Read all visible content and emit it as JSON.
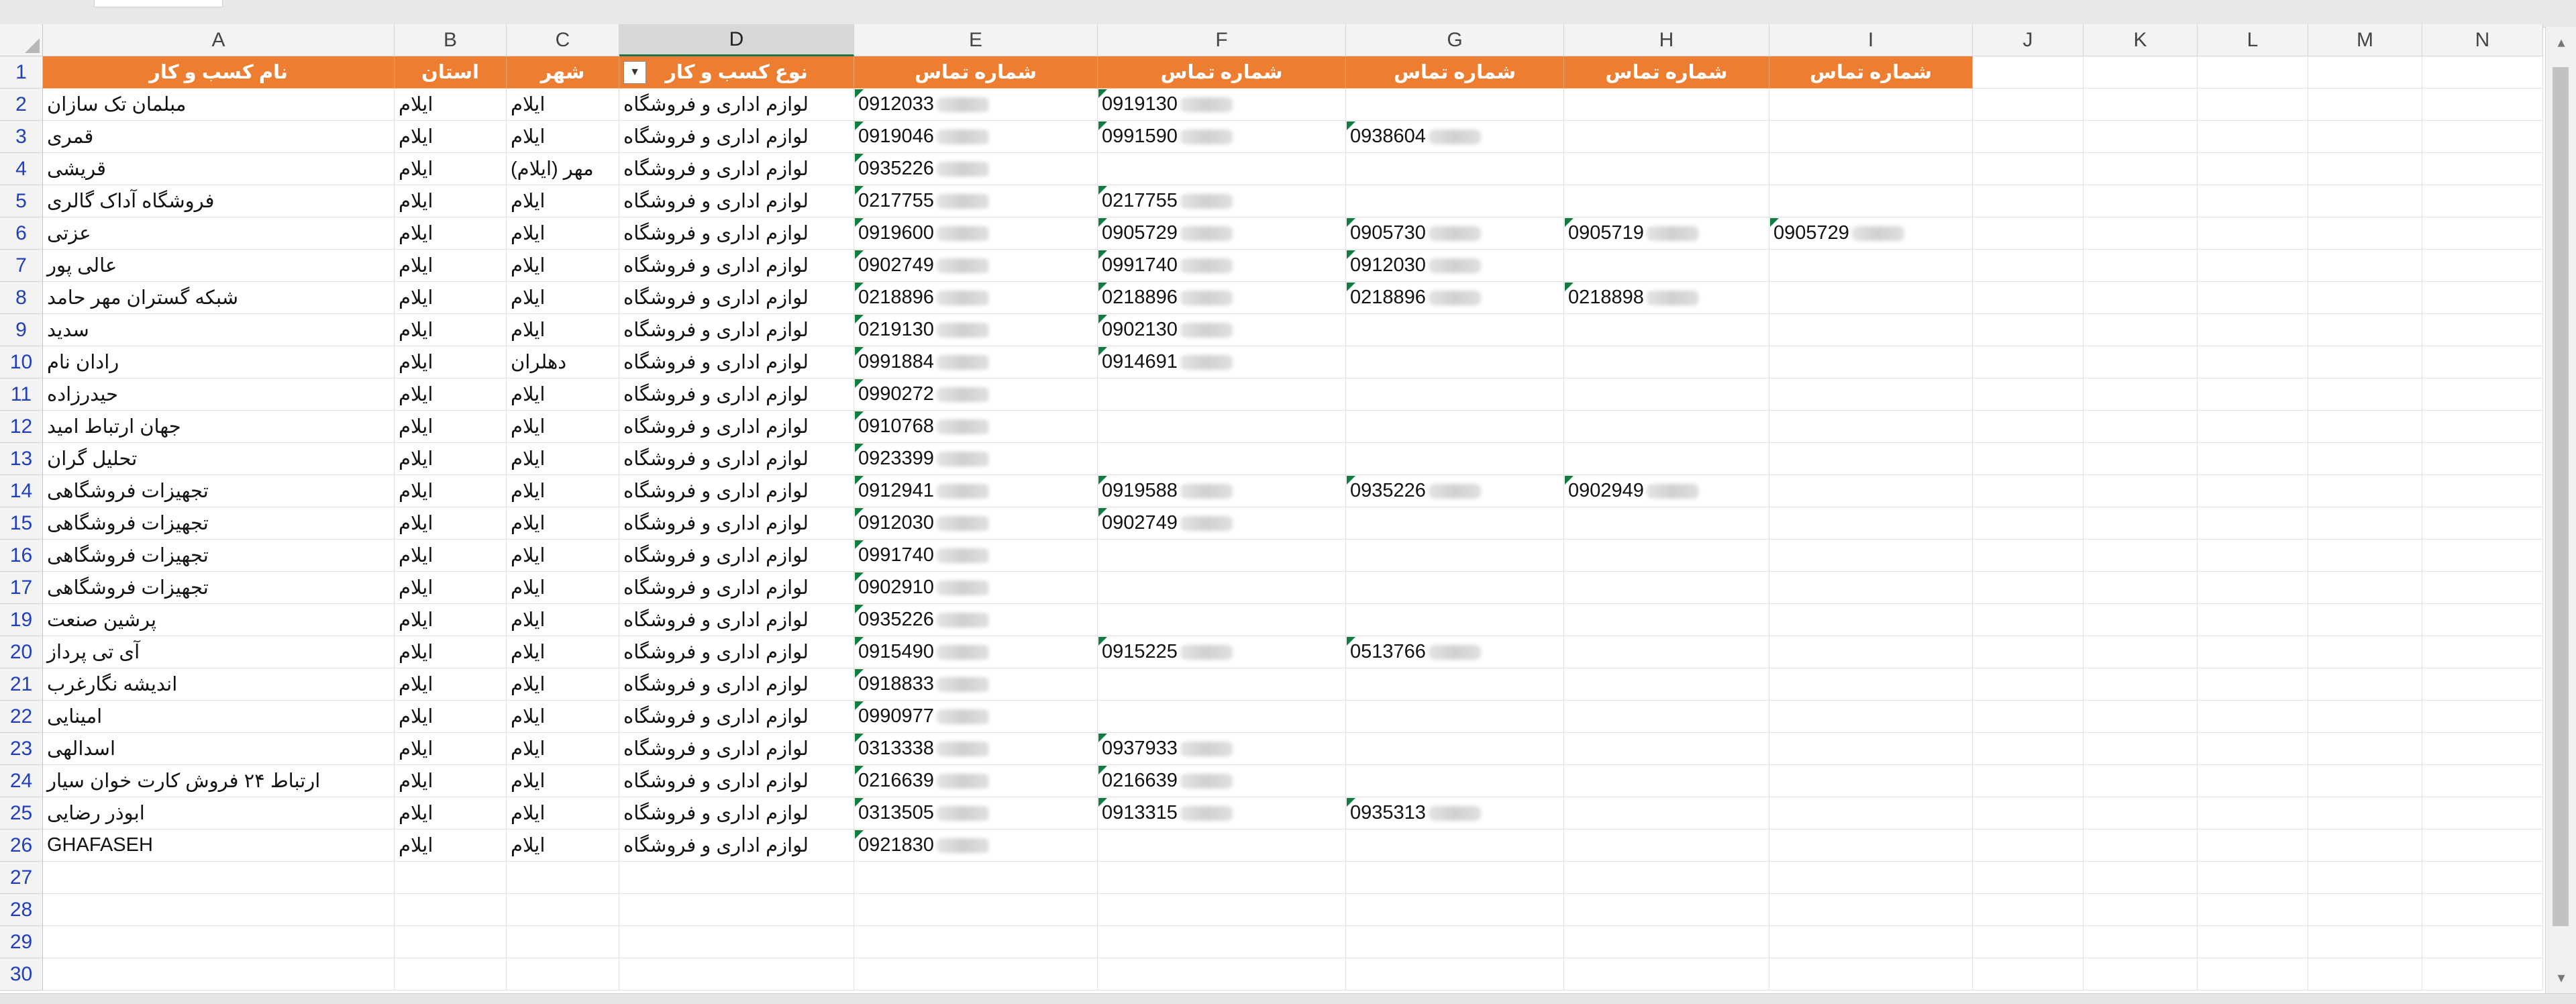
{
  "columns": [
    "A",
    "B",
    "C",
    "D",
    "E",
    "F",
    "G",
    "H",
    "I",
    "J",
    "K",
    "L",
    "M",
    "N"
  ],
  "selected_column": "D",
  "header_row": {
    "row": "1",
    "cells": [
      "نام کسب و کار",
      "استان",
      "شهر",
      "نوع کسب و کار",
      "شماره تماس",
      "شماره تماس",
      "شماره تماس",
      "شماره تماس",
      "شماره تماس"
    ]
  },
  "filter_icon": "filter-funnel-icon",
  "accent_color": "#ed7d31",
  "rows": [
    {
      "num": "2",
      "name": "مبلمان تک سازان",
      "province": "ایلام",
      "city": "ایلام",
      "type": "لوازم اداری و فروشگاه",
      "phones": [
        "0912033",
        "0919130"
      ]
    },
    {
      "num": "3",
      "name": "قمری",
      "province": "ایلام",
      "city": "ایلام",
      "type": "لوازم اداری و فروشگاه",
      "phones": [
        "0919046",
        "0991590",
        "0938604"
      ]
    },
    {
      "num": "4",
      "name": "قریشی",
      "province": "ایلام",
      "city": "مهر (ایلام)",
      "type": "لوازم اداری و فروشگاه",
      "phones": [
        "0935226"
      ]
    },
    {
      "num": "5",
      "name": "فروشگاه آداک گالری",
      "province": "ایلام",
      "city": "ایلام",
      "type": "لوازم اداری و فروشگاه",
      "phones": [
        "0217755",
        "0217755"
      ]
    },
    {
      "num": "6",
      "name": "عزتی",
      "province": "ایلام",
      "city": "ایلام",
      "type": "لوازم اداری و فروشگاه",
      "phones": [
        "0919600",
        "0905729",
        "0905730",
        "0905719",
        "0905729"
      ]
    },
    {
      "num": "7",
      "name": "عالی پور",
      "province": "ایلام",
      "city": "ایلام",
      "type": "لوازم اداری و فروشگاه",
      "phones": [
        "0902749",
        "0991740",
        "0912030"
      ]
    },
    {
      "num": "8",
      "name": "شبکه گستران مهر حامد",
      "province": "ایلام",
      "city": "ایلام",
      "type": "لوازم اداری و فروشگاه",
      "phones": [
        "0218896",
        "0218896",
        "0218896",
        "0218898"
      ]
    },
    {
      "num": "9",
      "name": "سدید",
      "province": "ایلام",
      "city": "ایلام",
      "type": "لوازم اداری و فروشگاه",
      "phones": [
        "0219130",
        "0902130"
      ]
    },
    {
      "num": "10",
      "name": "رادان نام",
      "province": "ایلام",
      "city": "دهلران",
      "type": "لوازم اداری و فروشگاه",
      "phones": [
        "0991884",
        "0914691"
      ]
    },
    {
      "num": "11",
      "name": "حیدرزاده",
      "province": "ایلام",
      "city": "ایلام",
      "type": "لوازم اداری و فروشگاه",
      "phones": [
        "0990272"
      ]
    },
    {
      "num": "12",
      "name": "جهان ارتباط امید",
      "province": "ایلام",
      "city": "ایلام",
      "type": "لوازم اداری و فروشگاه",
      "phones": [
        "0910768"
      ]
    },
    {
      "num": "13",
      "name": "تحلیل گران",
      "province": "ایلام",
      "city": "ایلام",
      "type": "لوازم اداری و فروشگاه",
      "phones": [
        "0923399"
      ]
    },
    {
      "num": "14",
      "name": "تجهیزات فروشگاهی",
      "province": "ایلام",
      "city": "ایلام",
      "type": "لوازم اداری و فروشگاه",
      "phones": [
        "0912941",
        "0919588",
        "0935226",
        "0902949"
      ]
    },
    {
      "num": "15",
      "name": "تجهیزات فروشگاهی",
      "province": "ایلام",
      "city": "ایلام",
      "type": "لوازم اداری و فروشگاه",
      "phones": [
        "0912030",
        "0902749"
      ]
    },
    {
      "num": "16",
      "name": "تجهیزات فروشگاهی",
      "province": "ایلام",
      "city": "ایلام",
      "type": "لوازم اداری و فروشگاه",
      "phones": [
        "0991740"
      ]
    },
    {
      "num": "17",
      "name": "تجهیزات فروشگاهی",
      "province": "ایلام",
      "city": "ایلام",
      "type": "لوازم اداری و فروشگاه",
      "phones": [
        "0902910"
      ]
    },
    {
      "num": "19",
      "name": "پرشین صنعت",
      "province": "ایلام",
      "city": "ایلام",
      "type": "لوازم اداری و فروشگاه",
      "phones": [
        "0935226"
      ]
    },
    {
      "num": "20",
      "name": "آی تی پرداز",
      "province": "ایلام",
      "city": "ایلام",
      "type": "لوازم اداری و فروشگاه",
      "phones": [
        "0915490",
        "0915225",
        "0513766"
      ]
    },
    {
      "num": "21",
      "name": "اندیشه نگارغرب",
      "province": "ایلام",
      "city": "ایلام",
      "type": "لوازم اداری و فروشگاه",
      "phones": [
        "0918833"
      ]
    },
    {
      "num": "22",
      "name": "امینایی",
      "province": "ایلام",
      "city": "ایلام",
      "type": "لوازم اداری و فروشگاه",
      "phones": [
        "0990977"
      ]
    },
    {
      "num": "23",
      "name": "اسدالهی",
      "province": "ایلام",
      "city": "ایلام",
      "type": "لوازم اداری و فروشگاه",
      "phones": [
        "0313338",
        "0937933"
      ]
    },
    {
      "num": "24",
      "name": "ارتباط ۲۴ فروش کارت خوان سیار",
      "province": "ایلام",
      "city": "ایلام",
      "type": "لوازم اداری و فروشگاه",
      "phones": [
        "0216639",
        "0216639"
      ]
    },
    {
      "num": "25",
      "name": "ابوذر رضایی",
      "province": "ایلام",
      "city": "ایلام",
      "type": "لوازم اداری و فروشگاه",
      "phones": [
        "0313505",
        "0913315",
        "0935313"
      ]
    },
    {
      "num": "26",
      "name": "GHAFASEH",
      "province": "ایلام",
      "city": "ایلام",
      "type": "لوازم اداری و فروشگاه",
      "phones": [
        "0921830"
      ]
    }
  ],
  "empty_rows": [
    "27",
    "28",
    "29",
    "30"
  ]
}
